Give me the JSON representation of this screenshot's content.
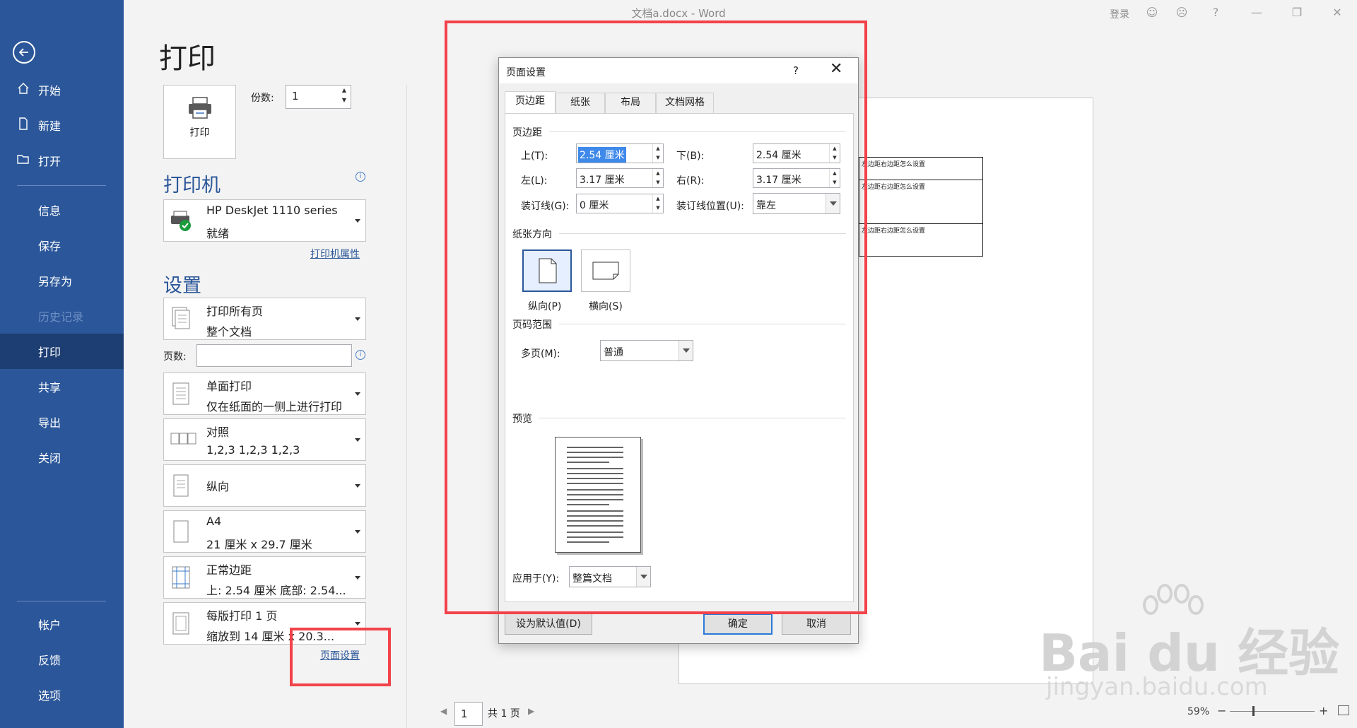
{
  "window": {
    "title": "文档a.docx - Word",
    "login": "登录"
  },
  "nav": {
    "items": [
      {
        "label": "开始",
        "icon": "home-icon"
      },
      {
        "label": "新建",
        "icon": "new-doc-icon"
      },
      {
        "label": "打开",
        "icon": "folder-open-icon"
      },
      {
        "label": "信息"
      },
      {
        "label": "保存"
      },
      {
        "label": "另存为"
      },
      {
        "label": "历史记录"
      },
      {
        "label": "打印"
      },
      {
        "label": "共享"
      },
      {
        "label": "导出"
      },
      {
        "label": "关闭"
      },
      {
        "label": "帐户"
      },
      {
        "label": "反馈"
      },
      {
        "label": "选项"
      }
    ]
  },
  "print": {
    "title": "打印",
    "button_label": "打印",
    "copies_label": "份数:",
    "copies_value": "1",
    "printer_heading": "打印机",
    "printer_name": "HP DeskJet 1110 series",
    "printer_status": "就绪",
    "printer_properties": "打印机属性",
    "settings_heading": "设置",
    "pages_label": "页数:",
    "pages_value": "",
    "settings": [
      {
        "line1": "打印所有页",
        "line2": "整个文档"
      },
      {
        "line1": "单面打印",
        "line2": "仅在纸面的一侧上进行打印"
      },
      {
        "line1": "对照",
        "line2": "1,2,3    1,2,3    1,2,3"
      },
      {
        "line1": "纵向",
        "line2": ""
      },
      {
        "line1": "A4",
        "line2": "21 厘米 x 29.7 厘米"
      },
      {
        "line1": "正常边距",
        "line2": "上: 2.54 厘米 底部: 2.54..."
      },
      {
        "line1": "每版打印 1 页",
        "line2": "缩放到 14 厘米 x 20.3..."
      }
    ],
    "page_setup_link": "页面设置"
  },
  "preview": {
    "table_cell_text": "左边距右边距怎么设置",
    "pager_value": "1",
    "pager_total": "共 1 页",
    "zoom": "59%"
  },
  "dialog": {
    "title": "页面设置",
    "help": "?",
    "tabs": [
      "页边距",
      "纸张",
      "布局",
      "文档网格"
    ],
    "margins_group": "页边距",
    "top_label": "上(T):",
    "top_value": "2.54 厘米",
    "bottom_label": "下(B):",
    "bottom_value": "2.54 厘米",
    "left_label": "左(L):",
    "left_value": "3.17 厘米",
    "right_label": "右(R):",
    "right_value": "3.17 厘米",
    "gutter_label": "装订线(G):",
    "gutter_value": "0 厘米",
    "gutter_pos_label": "装订线位置(U):",
    "gutter_pos_value": "靠左",
    "orientation_group": "纸张方向",
    "portrait_label": "纵向(P)",
    "landscape_label": "横向(S)",
    "page_range_group": "页码范围",
    "multiple_pages_label": "多页(M):",
    "multiple_pages_value": "普通",
    "preview_group": "预览",
    "apply_to_label": "应用于(Y):",
    "apply_to_value": "整篇文档",
    "default_button": "设为默认值(D)",
    "ok_button": "确定",
    "cancel_button": "取消"
  },
  "watermark": {
    "big": "Bai du 经验",
    "small": "jingyan.baidu.com"
  },
  "colors": {
    "nav_bg": "#2b579a",
    "nav_active": "#1d3e73",
    "accent": "#2b579a",
    "annotation": "#f2424a"
  }
}
